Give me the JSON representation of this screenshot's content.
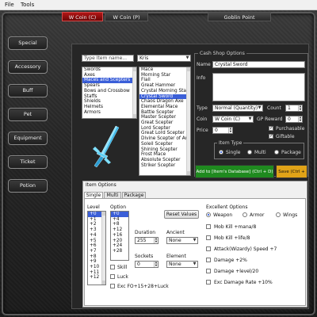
{
  "menu": {
    "file": "File",
    "tools": "Tools"
  },
  "top_tabs": [
    "W Coin (C)",
    "W Coin (P)",
    "Goblin Point"
  ],
  "side_buttons": [
    "Special",
    "Accessory",
    "Buff",
    "Pet",
    "Equipment",
    "Ticket",
    "Potion"
  ],
  "search": {
    "placeholder": "Type Item name...",
    "filter_value": "Kris"
  },
  "categories": [
    "Swords",
    "Axes",
    "Maces and Scepters",
    "Spears",
    "Bows and Crossbow",
    "Staffs",
    "Shields",
    "Helmets",
    "Armors"
  ],
  "categories_selected_index": 2,
  "items": [
    "Mace",
    "Morning Star",
    "Flail",
    "Great Hammer",
    "Crystal Morning Star",
    "Crystal Sword",
    "Chaos Dragon Axe",
    "Elemental Mace",
    "Battle Scepter",
    "Master Scepter",
    "Great Scepter",
    "Lord Scepter",
    "Great Lord Scepter",
    "Divine Scepter of Arc",
    "Soleil Scepter",
    "Shining Scepter",
    "Frost Mace",
    "Absolute Scepter",
    "Striker Scepter"
  ],
  "items_selected_index": 5,
  "cash_shop": {
    "title": "Cash Shop Options",
    "name_label": "Name",
    "name_value": "Crystal Sword",
    "info_label": "Info",
    "type_label": "Type",
    "type_value": "Normal (Quantity)",
    "count_label": "Count",
    "count_value": "1",
    "coin_label": "Coin",
    "coin_value": "W Coin (C)",
    "reward_label": "GP Reward",
    "reward_value": "0",
    "price_label": "Price",
    "price_value": "0",
    "purchasable_label": "Purchasable",
    "purchasable_checked": true,
    "giftable_label": "Giftable",
    "giftable_checked": true,
    "item_type_title": "Item Type",
    "item_type_options": [
      "Single",
      "Multi",
      "Package"
    ],
    "item_type_selected": "Single",
    "add_button": "Add to [Item's Database] (Ctrl + D)",
    "save_button": "Save (Ctrl + S)"
  },
  "item_options": {
    "title": "Item Options",
    "tabs": [
      "Single",
      "Multi",
      "Package"
    ],
    "active_tab": "Single",
    "level_label": "Level",
    "levels": [
      "+0",
      "+1",
      "+2",
      "+3",
      "+4",
      "+5",
      "+6",
      "+7",
      "+8",
      "+9",
      "+10",
      "+11",
      "+12"
    ],
    "option_label": "Option",
    "options": [
      "+0",
      "+4",
      "+8",
      "+12",
      "+16",
      "+20",
      "+24",
      "+28"
    ],
    "skill_label": "Skill",
    "luck_label": "Luck",
    "exc_fo_label": "Exc FO+15+28+Luck",
    "reset_button": "Reset Values",
    "duration_label": "Duration",
    "duration_value": "255",
    "sockets_label": "Sockets",
    "sockets_value": "0",
    "ancient_label": "Ancient",
    "ancient_value": "None",
    "element_label": "Element",
    "element_value": "None",
    "excellent_title": "Excellent Options",
    "excellent_types": [
      "Weapon",
      "Armor",
      "Wings"
    ],
    "excellent_type_selected": "Weapon",
    "excellent_options": [
      "Mob Kill +mana/8",
      "Mob Kill +life/8",
      "Attack(Wizardy) Speed +7",
      "Damage +2%",
      "Damage +level/20",
      "Exc Damage Rate +10%"
    ]
  },
  "colors": {
    "active_tab": "#b21515",
    "add_button": "#1f8a1f",
    "save_button": "#e0a318",
    "selection": "#3b5fd8"
  }
}
